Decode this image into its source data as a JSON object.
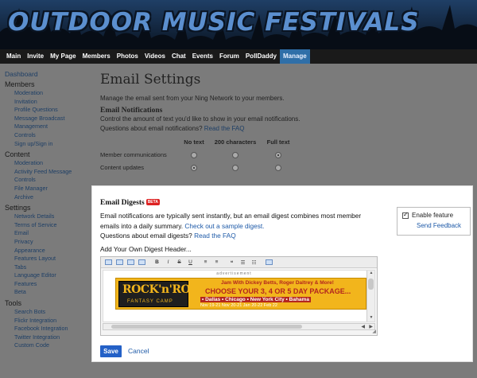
{
  "banner": {
    "title": "OUTDOOR MUSIC FESTIVALS"
  },
  "nav": {
    "items": [
      "Main",
      "Invite",
      "My Page",
      "Members",
      "Photos",
      "Videos",
      "Chat",
      "Events",
      "Forum",
      "PollDaddy",
      "Manage"
    ],
    "active": "Manage"
  },
  "sidebar": {
    "dashboard": "Dashboard",
    "sections": [
      {
        "title": "Members",
        "items": [
          "Moderation",
          "Invitation",
          "Profile Questions",
          "Message Broadcast",
          "Management",
          "Controls",
          "Sign up/Sign in"
        ]
      },
      {
        "title": "Content",
        "items": [
          "Moderation",
          "Activity Feed Message",
          "Controls",
          "File Manager",
          "Archive"
        ]
      },
      {
        "title": "Settings",
        "items": [
          "Network Details",
          "Terms of Service",
          "Email",
          "Privacy",
          "Appearance",
          "Features Layout",
          "Tabs",
          "Language Editor",
          "Features",
          "Beta"
        ]
      },
      {
        "title": "Tools",
        "items": [
          "Search Bots",
          "Flickr Integration",
          "Facebook Integration",
          "Twitter Integration",
          "Custom Code"
        ]
      }
    ]
  },
  "main": {
    "title": "Email Settings",
    "intro": "Manage the email sent from your Ning Network to your members.",
    "notifications": {
      "heading": "Email Notifications",
      "text": "Control the amount of text you'd like to show in your email notifications.",
      "question": "Questions about email notifications?",
      "faq": "Read the FAQ",
      "columns": [
        "No text",
        "200 characters",
        "Full text"
      ],
      "rows": [
        {
          "label": "Member communications",
          "selected": 2
        },
        {
          "label": "Content updates",
          "selected": 0
        }
      ]
    }
  },
  "digest": {
    "title": "Email Digests",
    "badge": "BETA",
    "desc_part1": "Email notifications are typically sent instantly, but an email digest combines most member emails into a daily summary.",
    "sample_link": "Check out a sample digest.",
    "question": "Questions about email digests?",
    "faq": "Read the FAQ",
    "header_label": "Add Your Own Digest Header...",
    "enable_label": "Enable feature",
    "enabled": true,
    "feedback": "Send Feedback"
  },
  "ad": {
    "label": "advertisement",
    "logo_line1": "ROCK'n'ROLL",
    "logo_line2": "FANTASY CAMP",
    "line1": "Jam With Dickey Betts, Roger Daltrey & More!",
    "line2": "CHOOSE YOUR 3, 4 OR 5 DAY PACKAGE...",
    "line3": "• Dallas   • Chicago   • New York City   • Bahama",
    "line4": "Nov 19-21        Nov 20-21        Jan 20-22        Feb 22"
  },
  "buttons": {
    "save": "Save",
    "cancel": "Cancel"
  },
  "colors": {
    "nav_active": "#2f6fa8",
    "save_button": "#2461c7",
    "link": "#1e5aa8",
    "badge": "#dd2222"
  }
}
